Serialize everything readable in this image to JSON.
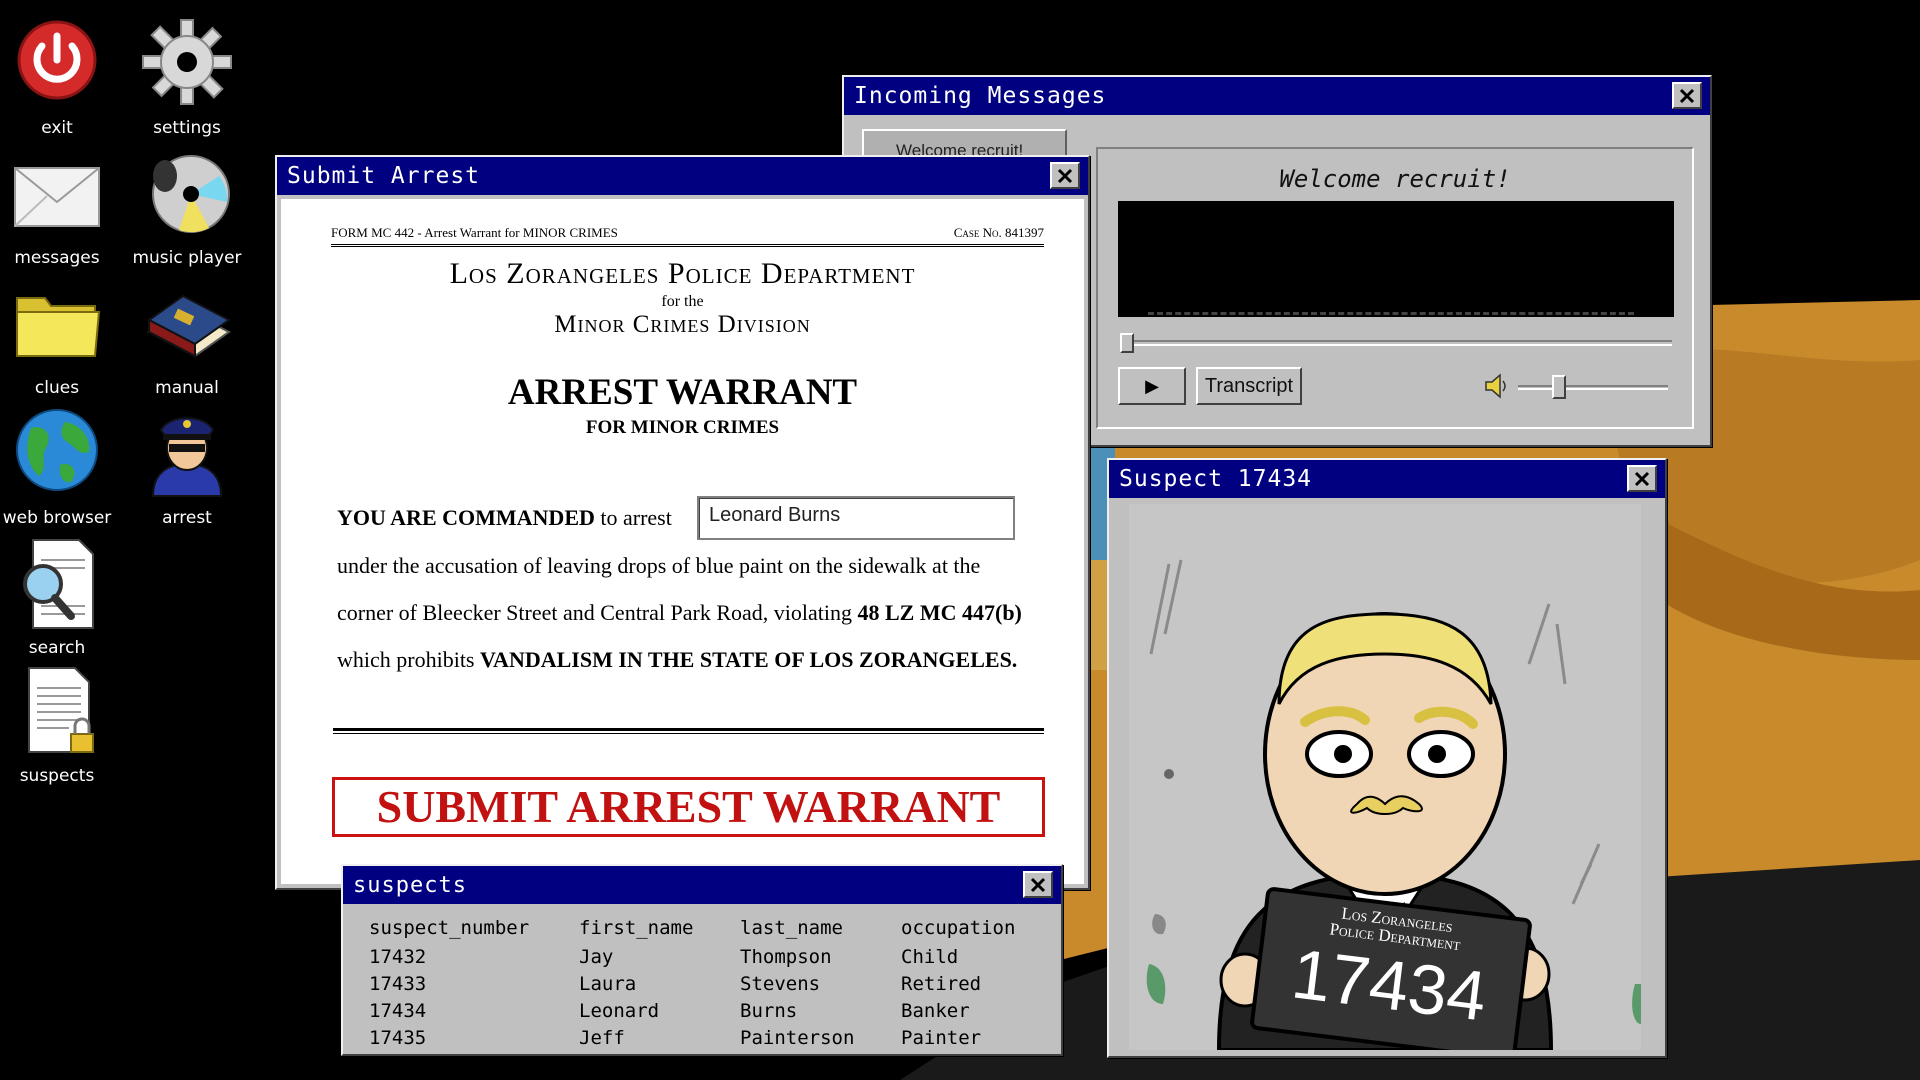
{
  "desktop": {
    "icons": [
      {
        "label": "exit",
        "icon": "power-icon"
      },
      {
        "label": "settings",
        "icon": "gear-icon"
      },
      {
        "label": "messages",
        "icon": "envelope-icon"
      },
      {
        "label": "music player",
        "icon": "cd-icon"
      },
      {
        "label": "clues",
        "icon": "folder-icon"
      },
      {
        "label": "manual",
        "icon": "book-icon"
      },
      {
        "label": "web browser",
        "icon": "globe-icon"
      },
      {
        "label": "arrest",
        "icon": "police-officer-icon"
      },
      {
        "label": "search",
        "icon": "magnifier-document-icon"
      },
      {
        "label": "suspects",
        "icon": "locked-document-icon"
      }
    ]
  },
  "arrest_window": {
    "title": "Submit Arrest",
    "form_id": "FORM MC 442 - Arrest Warrant for MINOR CRIMES",
    "case_no": "Case No. 841397",
    "department": "Los Zorangeles Police Department",
    "for_the": "for the",
    "division": "Minor Crimes Division",
    "heading": "ARREST WARRANT",
    "subheading": "FOR MINOR CRIMES",
    "commanded": "YOU ARE COMMANDED",
    "to_arrest": " to arrest",
    "arrestee_value": "Leonard Burns",
    "line1": "under the accusation of leaving drops of blue paint on the sidewalk at the",
    "line2a": "corner of Bleecker Street and Central Park Road, violating ",
    "line2b": "48 LZ MC 447(b)",
    "line3a": "which prohibits ",
    "line3b": "VANDALISM IN THE STATE OF LOS ZORANGELES.",
    "submit_label": "SUBMIT ARREST WARRANT"
  },
  "messages_window": {
    "title": "Incoming Messages",
    "tab_label": "Welcome recruit!",
    "message_title": "Welcome recruit!",
    "transcript_label": "Transcript",
    "play_glyph": "▶",
    "seek_position": 0.0,
    "volume": 0.25
  },
  "suspect_window": {
    "title": "Suspect 17434",
    "placard_line1": "Los Zorangeles",
    "placard_line2": "Police Department",
    "placard_number": "17434"
  },
  "suspects_table": {
    "title": "suspects",
    "columns": [
      "suspect_number",
      "first_name",
      "last_name",
      "occupation"
    ],
    "rows": [
      [
        "17432",
        "Jay",
        "Thompson",
        "Child"
      ],
      [
        "17433",
        "Laura",
        "Stevens",
        "Retired"
      ],
      [
        "17434",
        "Leonard",
        "Burns",
        "Banker"
      ],
      [
        "17435",
        "Jeff",
        "Painterson",
        "Painter"
      ]
    ]
  },
  "colors": {
    "titlebar": "#000080",
    "window_face": "#c0c0c0",
    "submit_red": "#c21111",
    "desert": "#c98a2c"
  }
}
